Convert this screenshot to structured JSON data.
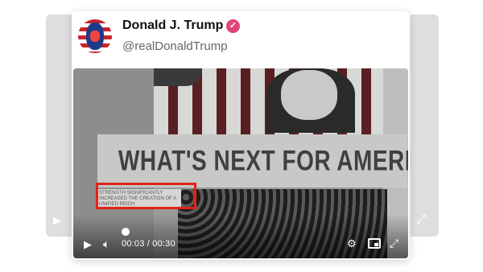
{
  "account": {
    "name": "Donald J. Trump",
    "handle": "@realDonaldTrump",
    "verified_color": "#e0457b"
  },
  "video": {
    "headline": "WHAT'S NEXT FOR AMERICA?",
    "caption": "STRENGTH SIGNIFICANTLY INCREASED THE CREATION OF A UNIFIED REICH",
    "time_display": "00:03 / 00:30",
    "progress": 0.1
  },
  "icons": {
    "play": "play-icon",
    "volume": "volume-icon",
    "settings": "gear-icon",
    "pip": "picture-in-picture-icon",
    "fullscreen": "fullscreen-icon"
  },
  "colors": {
    "highlight_box": "#e2231a"
  }
}
